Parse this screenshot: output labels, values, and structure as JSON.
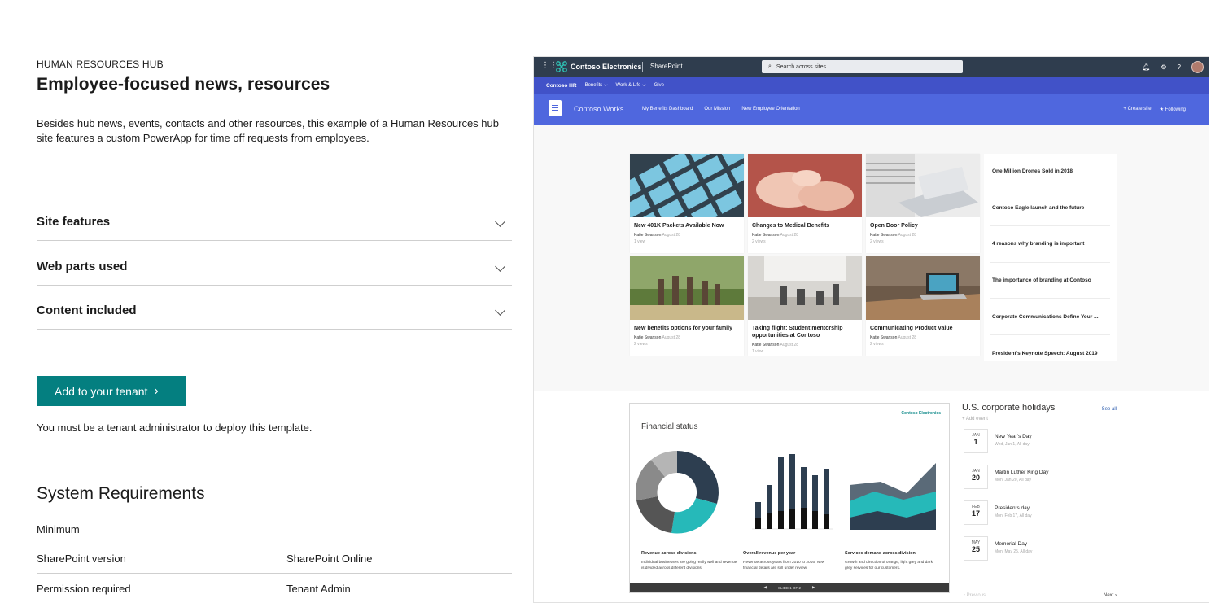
{
  "eyebrow": "HUMAN RESOURCES HUB",
  "title": "Employee-focused news, resources",
  "description": "Besides hub news, events, contacts and other resources, this example of a Human Resources hub site features a custom PowerApp for time off requests from employees.",
  "accordion": [
    {
      "label": "Site features"
    },
    {
      "label": "Web parts used"
    },
    {
      "label": "Content included"
    }
  ],
  "cta": {
    "label": "Add to your tenant",
    "chevron": "›"
  },
  "note": "You must be a tenant administrator to deploy this template.",
  "system_requirements": {
    "title": "System Requirements",
    "rows": [
      {
        "label": "Minimum",
        "value": ""
      },
      {
        "label": "SharePoint version",
        "value": "SharePoint Online"
      },
      {
        "label": "Permission required",
        "value": "Tenant Admin"
      }
    ]
  },
  "preview": {
    "suitebar": {
      "brand": "Contoso Electronics",
      "app": "SharePoint",
      "search_placeholder": "Search across sites",
      "icons": [
        "bell-icon",
        "gear-icon",
        "help-icon"
      ],
      "help_glyph": "?"
    },
    "hubnav": {
      "name": "Contoso HR",
      "items": [
        "Benefits ⌵",
        "Work & Life ⌵",
        "Give"
      ]
    },
    "site": {
      "title": "Contoso Works",
      "links": [
        "My Benefits Dashboard",
        "Our Mission",
        "New Employee Orientation"
      ],
      "create": "+ Create site",
      "follow": "★ Following"
    },
    "news": [
      {
        "title": "New 401K Packets Available Now",
        "author": "Katie Swanson",
        "date": "August 28",
        "views": "1 view"
      },
      {
        "title": "Changes to Medical Benefits",
        "author": "Katie Swanson",
        "date": "August 28",
        "views": "2 views"
      },
      {
        "title": "Open Door Policy",
        "author": "Katie Swanson",
        "date": "August 28",
        "views": "2 views"
      },
      {
        "title": "New benefits options for your family",
        "author": "Katie Swanson",
        "date": "August 28",
        "views": "2 views"
      },
      {
        "title": "Taking flight: Student mentorship opportunities at Contoso",
        "author": "Katie Swanson",
        "date": "August 28",
        "views": "1 view"
      },
      {
        "title": "Communicating Product Value",
        "author": "Katie Swanson",
        "date": "August 28",
        "views": "2 views"
      }
    ],
    "headlines": [
      "One Million Drones Sold in 2018",
      "Contoso Eagle launch and the future",
      "4 reasons why branding is important",
      "The importance of branding at Contoso",
      "Corporate Communications Define Your ...",
      "President's Keynote Speech: August 2019"
    ],
    "financial": {
      "title": "Financial status",
      "brand": "Contoso Electronics",
      "captions": [
        {
          "h": "Revenue across divisions",
          "b": "Individual businesses are going really well and revenue is divided across different divisions."
        },
        {
          "h": "Overall revenue per year",
          "b": "Revenue across years from 2010 to 2016. New financial details are still under review."
        },
        {
          "h": "Services demand across division",
          "b": "Growth and direction of orange, light grey and dark grey services for our customers."
        }
      ],
      "footer": "SLIDE 1 OF 2"
    },
    "holidays": {
      "title": "U.S. corporate holidays",
      "see_all": "See all",
      "add": "+ Add event",
      "items": [
        {
          "month": "JAN",
          "day": "1",
          "name": "New Year's Day",
          "sub": "Wed, Jan 1, All day"
        },
        {
          "month": "JAN",
          "day": "20",
          "name": "Martin Luther King Day",
          "sub": "Mon, Jan 20, All day"
        },
        {
          "month": "FEB",
          "day": "17",
          "name": "Presidents day",
          "sub": "Mon, Feb 17, All day"
        },
        {
          "month": "MAY",
          "day": "25",
          "name": "Memorial Day",
          "sub": "Mon, May 25, All day"
        }
      ],
      "prev": "‹ Previous",
      "next": "Next ›"
    }
  }
}
